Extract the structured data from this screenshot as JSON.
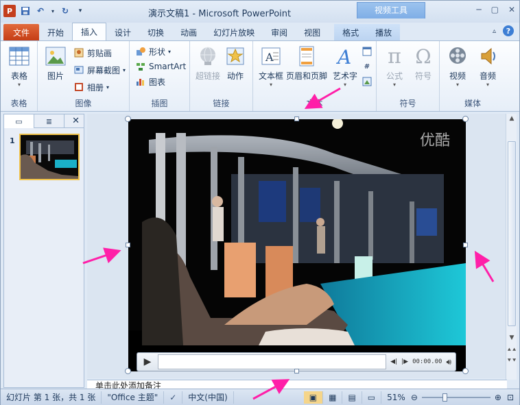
{
  "window": {
    "title": "演示文稿1 - Microsoft PowerPoint",
    "context_tool": "视频工具",
    "app_icon": "P"
  },
  "tabs": [
    {
      "label": "文件"
    },
    {
      "label": "开始"
    },
    {
      "label": "插入"
    },
    {
      "label": "设计"
    },
    {
      "label": "切换"
    },
    {
      "label": "动画"
    },
    {
      "label": "幻灯片放映"
    },
    {
      "label": "审阅"
    },
    {
      "label": "视图"
    },
    {
      "label": "格式"
    },
    {
      "label": "播放"
    }
  ],
  "ribbon": {
    "groups": {
      "table": {
        "label": "表格",
        "table_btn": "表格"
      },
      "image": {
        "label": "图像",
        "picture": "图片",
        "clipart": "剪贴画",
        "screenshot": "屏幕截图",
        "album": "相册"
      },
      "illustration": {
        "label": "插图",
        "shapes": "形状",
        "smartart": "SmartArt",
        "chart": "图表"
      },
      "link": {
        "label": "链接",
        "hyperlink": "超链接",
        "action": "动作"
      },
      "text": {
        "label": "文本",
        "textbox": "文本框",
        "header_footer": "页眉和页脚",
        "wordart": "艺术字"
      },
      "symbol": {
        "label": "符号",
        "equation": "公式",
        "symbol": "符号",
        "pi": "π",
        "omega": "Ω"
      },
      "media": {
        "label": "媒体",
        "video": "视频",
        "audio": "音频"
      }
    }
  },
  "slide_panel": {
    "slide_number": "1"
  },
  "video": {
    "watermark": "优酷",
    "time": "00:00.00"
  },
  "notes": {
    "placeholder": "单击此处添加备注"
  },
  "status": {
    "slide_info": "幻灯片 第 1 张，共 1 张",
    "theme": "\"Office 主题\"",
    "language": "中文(中国)",
    "zoom": "51%"
  },
  "colors": {
    "file_tab": "#c53d15",
    "annotation_arrow": "#ff1fa8",
    "thumbnail_border": "#f0c24a"
  }
}
